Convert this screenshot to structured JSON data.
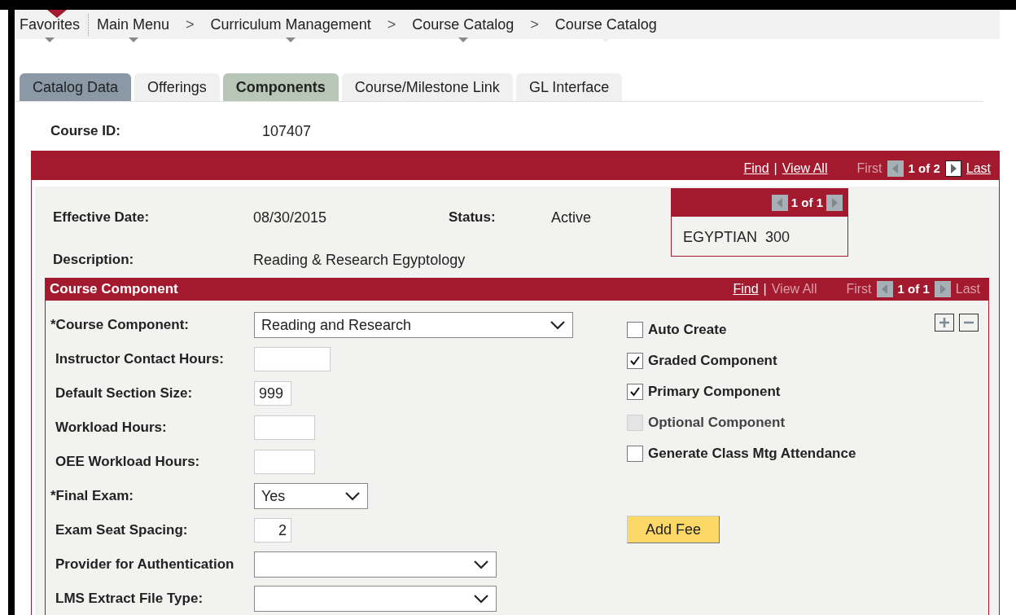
{
  "breadcrumb": [
    {
      "label": "Favorites",
      "menu": true
    },
    {
      "label": "Main Menu",
      "menu": true,
      "separator": ">"
    },
    {
      "label": "Curriculum Management",
      "menu": true,
      "separator": ">"
    },
    {
      "label": "Course Catalog",
      "menu": true,
      "separator": ">"
    },
    {
      "label": "Course Catalog",
      "menu": false
    }
  ],
  "tabs": [
    {
      "label": "Catalog Data",
      "selected": false,
      "color": "#8b99a6"
    },
    {
      "label": "Offerings",
      "selected": false,
      "color": "#f0f0f0"
    },
    {
      "label": "Components",
      "selected": true,
      "color": "#b7c6b7"
    },
    {
      "label": "Course/Milestone Link",
      "selected": false,
      "color": "#f0f0f0"
    },
    {
      "label": "GL Interface",
      "selected": false,
      "color": "#f0f0f0"
    }
  ],
  "course_id": {
    "label": "Course ID:",
    "value": "107407"
  },
  "catalog_nav": {
    "find": "Find",
    "separator": "|",
    "view_all": {
      "label": "View All",
      "disabled": false
    },
    "first": {
      "label": "First",
      "disabled": true
    },
    "prev_disabled": true,
    "counter": "1 of 2",
    "next_disabled": false,
    "last": {
      "label": "Last",
      "disabled": false
    }
  },
  "effective_date": {
    "label": "Effective Date:",
    "value": "08/30/2015"
  },
  "status": {
    "label": "Status:",
    "value": "Active"
  },
  "description": {
    "label": "Description:",
    "value": "Reading & Research Egyptology"
  },
  "offer_box": {
    "prev_disabled": true,
    "counter": "1 of 1",
    "next_disabled": true,
    "value": "EGYPTIAN  300"
  },
  "component_section": {
    "title": "Course Component",
    "nav": {
      "find": "Find",
      "separator": "|",
      "view_all": {
        "label": "View All",
        "disabled": true
      },
      "first": {
        "label": "First",
        "disabled": true
      },
      "prev_disabled": true,
      "counter": "1 of 1",
      "next_disabled": true,
      "last": {
        "label": "Last",
        "disabled": true
      }
    },
    "fields": [
      {
        "label": "*Course Component:",
        "kind": "select",
        "value": "Reading and Research"
      },
      {
        "label": "Instructor Contact Hours:",
        "kind": "text"
      },
      {
        "label": "Default Section Size:",
        "kind": "text",
        "value": "999"
      },
      {
        "label": "Workload Hours:",
        "kind": "text"
      },
      {
        "label": "OEE Workload Hours:",
        "kind": "text"
      },
      {
        "label": "*Final Exam:",
        "kind": "select",
        "value": "Yes"
      },
      {
        "label": "Exam Seat Spacing:",
        "kind": "text",
        "value": "2"
      },
      {
        "label": "Provider for Authentication",
        "kind": "select"
      },
      {
        "label": "LMS Extract File Type:",
        "kind": "select"
      }
    ],
    "checkboxes": [
      {
        "label": "Auto Create",
        "checked": false,
        "disabled": false
      },
      {
        "label": "Graded Component",
        "checked": true,
        "disabled": false
      },
      {
        "label": "Primary Component",
        "checked": true,
        "disabled": false
      },
      {
        "label": "Optional Component",
        "checked": false,
        "disabled": true
      },
      {
        "label": "Generate Class Mtg Attendance",
        "checked": false,
        "disabled": false
      }
    ],
    "add_fee_button": "Add Fee"
  }
}
